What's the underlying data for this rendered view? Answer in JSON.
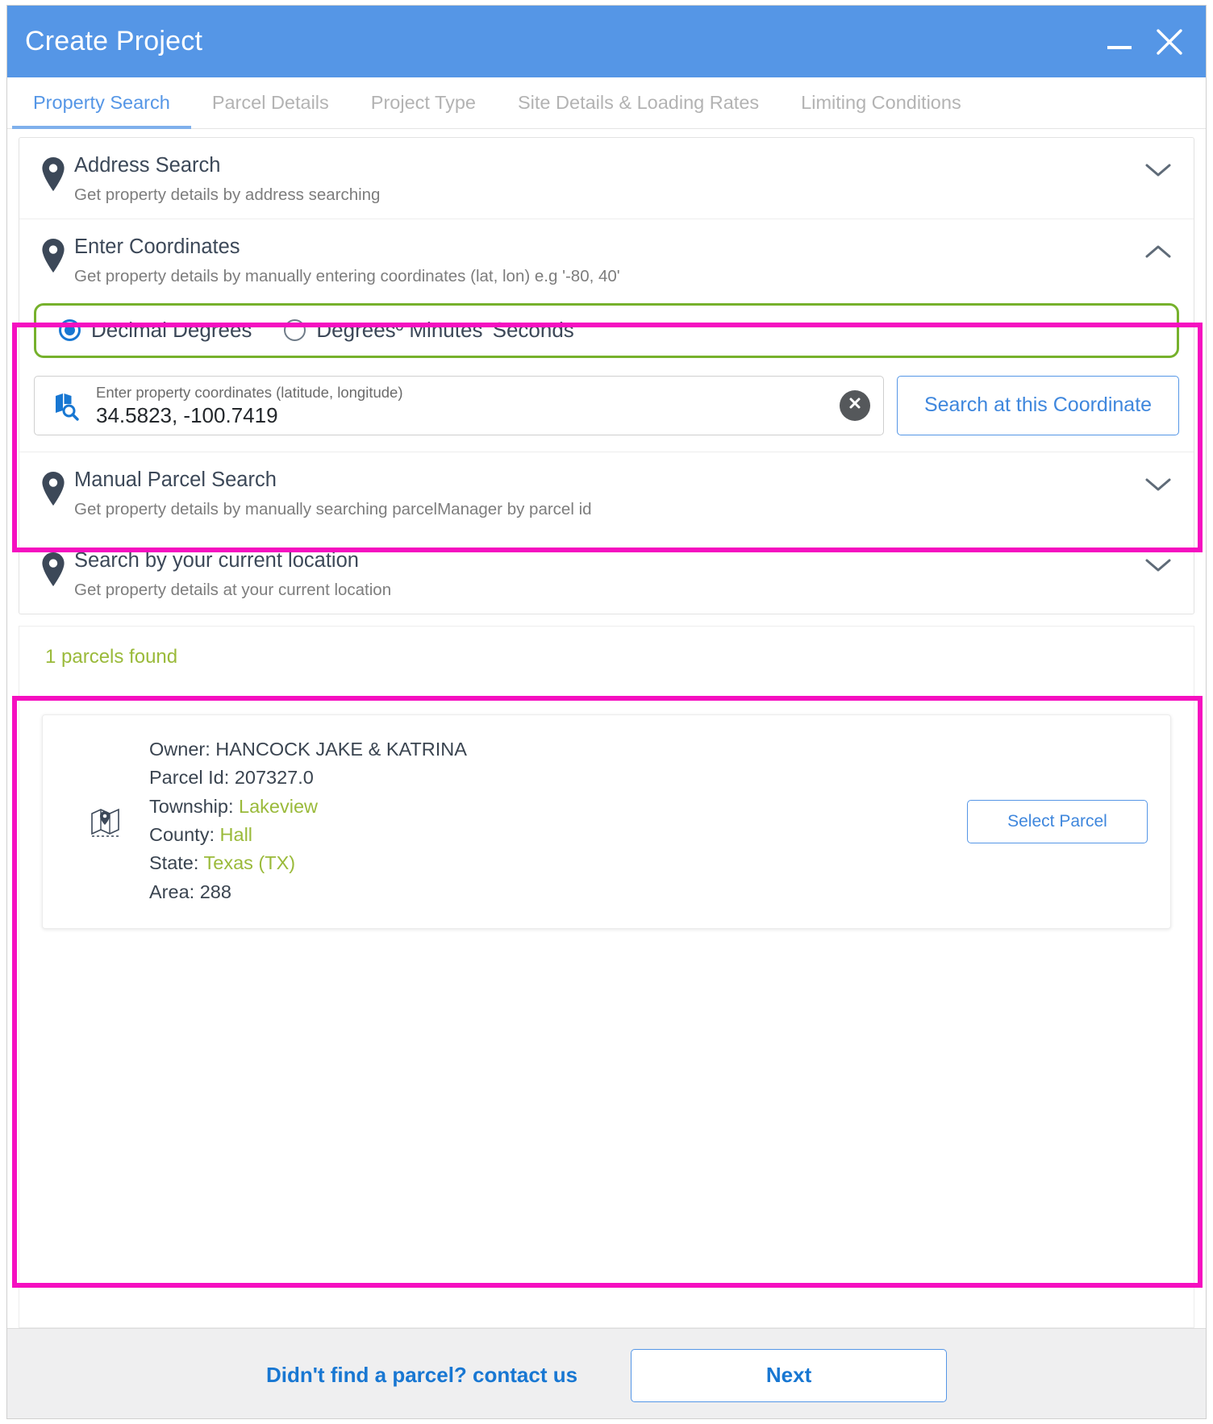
{
  "window": {
    "title": "Create Project",
    "minimize_label": "_",
    "close_label": "✕"
  },
  "tabs": [
    {
      "label": "Property Search",
      "active": true
    },
    {
      "label": "Parcel Details",
      "active": false
    },
    {
      "label": "Project Type",
      "active": false
    },
    {
      "label": "Site Details & Loading Rates",
      "active": false
    },
    {
      "label": "Limiting Conditions",
      "active": false
    }
  ],
  "accordion": {
    "address_search": {
      "title": "Address Search",
      "subtitle": "Get property details by address searching"
    },
    "enter_coordinates": {
      "title": "Enter Coordinates",
      "subtitle": "Get property details by manually entering coordinates (lat, lon) e.g '-80, 40'",
      "format_options": [
        {
          "label": "Decimal Degrees",
          "selected": true
        },
        {
          "label": "Degreesº Minutes' Seconds\"",
          "selected": false
        }
      ],
      "coordinate_input": {
        "placeholder": "Enter property coordinates (latitude, longitude)",
        "value": "34.5823, -100.7419"
      },
      "search_button_label": "Search at this Coordinate"
    },
    "manual_parcel_search": {
      "title": "Manual Parcel Search",
      "subtitle": "Get property details by manually searching parcelManager by parcel id"
    },
    "current_location": {
      "title": "Search by your current location",
      "subtitle": "Get property details at your current location"
    }
  },
  "results": {
    "count_text": "1 parcels found",
    "parcels": [
      {
        "owner_label": "Owner:",
        "owner_value": "HANCOCK JAKE & KATRINA",
        "parcel_id_label": "Parcel Id:",
        "parcel_id_value": "207327.0",
        "township_label": "Township:",
        "township_value": "Lakeview",
        "county_label": "County:",
        "county_value": "Hall",
        "state_label": "State:",
        "state_value": "Texas (TX)",
        "area_label": "Area:",
        "area_value": "288",
        "select_button_label": "Select Parcel"
      }
    ]
  },
  "footer": {
    "contact_link": "Didn't find a parcel? contact us",
    "next_label": "Next"
  },
  "colors": {
    "title_bar": "#5596e6",
    "accent_blue": "#1877d2",
    "highlight_magenta": "#f50fc0",
    "radio_border_green": "#76b12c",
    "result_green": "#9aba3a"
  },
  "icons": {
    "map_pin": "map-pin-icon",
    "chevron_down": "chevron-down-icon",
    "chevron_up": "chevron-up-icon",
    "map_search": "map-search-icon",
    "clear": "clear-icon",
    "parcel_thumb": "parcel-map-icon"
  }
}
